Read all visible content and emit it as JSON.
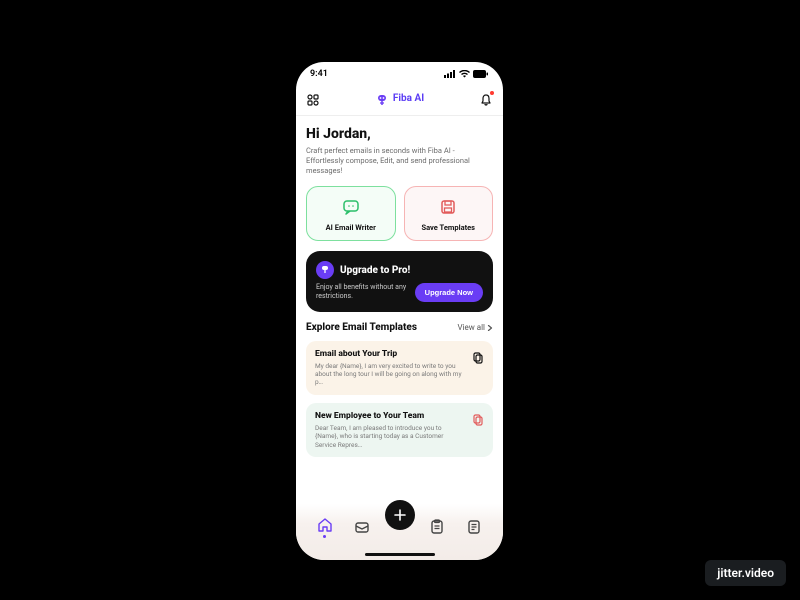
{
  "status": {
    "time": "9:41"
  },
  "brand": {
    "name": "Fiba AI"
  },
  "greeting": "Hi Jordan,",
  "subtext": "Craft perfect emails in seconds with Fiba AI - Effortlessly compose, Edit, and send professional messages!",
  "actions": {
    "writer": "AI Email Writer",
    "save": "Save Templates"
  },
  "pro": {
    "title": "Upgrade to Pro!",
    "subtitle": "Enjoy all benefits without any restrictions.",
    "cta": "Upgrade Now"
  },
  "section": {
    "title": "Explore Email Templates",
    "view_all": "View all"
  },
  "templates": [
    {
      "title": "Email about Your Trip",
      "body": "My dear {Name}, I am very excited to write to you about the long tour I will be going on along with my p…"
    },
    {
      "title": "New Employee to Your Team",
      "body": "Dear Team, I am pleased to introduce you to {Name}, who is starting today as a Customer Service Repres…"
    }
  ],
  "watermark": "jitter.video"
}
